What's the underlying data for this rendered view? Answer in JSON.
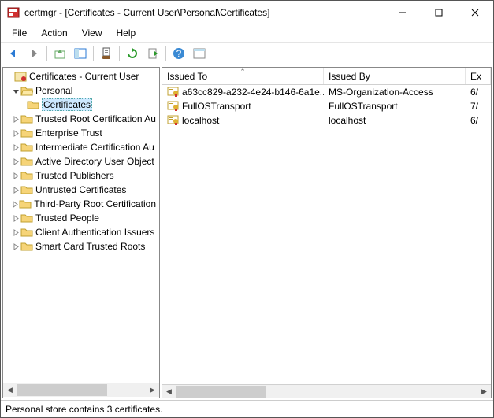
{
  "title": "certmgr - [Certificates - Current User\\Personal\\Certificates]",
  "menu": {
    "file": "File",
    "action": "Action",
    "view": "View",
    "help": "Help"
  },
  "tree": {
    "root": "Certificates - Current User",
    "items": [
      {
        "label": "Personal",
        "expanded": true,
        "children": [
          {
            "label": "Certificates",
            "selected": true
          }
        ]
      },
      {
        "label": "Trusted Root Certification Au"
      },
      {
        "label": "Enterprise Trust"
      },
      {
        "label": "Intermediate Certification Au"
      },
      {
        "label": "Active Directory User Object"
      },
      {
        "label": "Trusted Publishers"
      },
      {
        "label": "Untrusted Certificates"
      },
      {
        "label": "Third-Party Root Certification"
      },
      {
        "label": "Trusted People"
      },
      {
        "label": "Client Authentication Issuers"
      },
      {
        "label": "Smart Card Trusted Roots"
      }
    ]
  },
  "columns": {
    "issued_to": "Issued To",
    "issued_by": "Issued By",
    "expiration": "Ex"
  },
  "rows": [
    {
      "issued_to": "a63cc829-a232-4e24-b146-6a1e...",
      "issued_by": "MS-Organization-Access",
      "expiration": "6/"
    },
    {
      "issued_to": "FullOSTransport",
      "issued_by": "FullOSTransport",
      "expiration": "7/"
    },
    {
      "issued_to": "localhost",
      "issued_by": "localhost",
      "expiration": "6/"
    }
  ],
  "status": "Personal store contains 3 certificates."
}
